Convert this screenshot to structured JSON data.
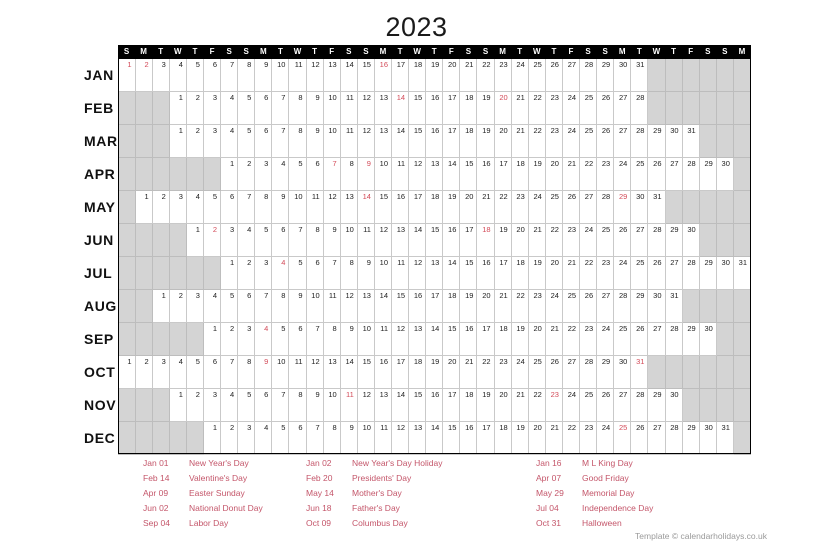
{
  "title": "2023",
  "calendar": {
    "year": 2023,
    "columns": 37,
    "dow_sequence": [
      "S",
      "M",
      "T",
      "W",
      "T",
      "F",
      "S"
    ],
    "header_labels": [
      "S",
      "M",
      "T",
      "W",
      "T",
      "F",
      "S",
      "S",
      "M",
      "T",
      "W",
      "T",
      "F",
      "S",
      "S",
      "M",
      "T",
      "W",
      "T",
      "F",
      "S",
      "S",
      "M",
      "T",
      "W",
      "T",
      "F",
      "S",
      "S",
      "M",
      "T",
      "W",
      "T",
      "F",
      "S",
      "S",
      "M"
    ],
    "months": [
      {
        "label": "JAN",
        "offset": 0,
        "days": 31,
        "holidays": [
          1,
          2,
          16
        ]
      },
      {
        "label": "FEB",
        "offset": 3,
        "days": 28,
        "holidays": [
          14,
          20
        ]
      },
      {
        "label": "MAR",
        "offset": 3,
        "days": 31,
        "holidays": []
      },
      {
        "label": "APR",
        "offset": 6,
        "days": 30,
        "holidays": [
          7,
          9
        ]
      },
      {
        "label": "MAY",
        "offset": 1,
        "days": 31,
        "holidays": [
          14,
          29
        ]
      },
      {
        "label": "JUN",
        "offset": 4,
        "days": 30,
        "holidays": [
          2,
          18
        ]
      },
      {
        "label": "JUL",
        "offset": 6,
        "days": 31,
        "holidays": [
          4
        ]
      },
      {
        "label": "AUG",
        "offset": 2,
        "days": 31,
        "holidays": []
      },
      {
        "label": "SEP",
        "offset": 5,
        "days": 30,
        "holidays": [
          4
        ]
      },
      {
        "label": "OCT",
        "offset": 0,
        "days": 31,
        "holidays": [
          9,
          31
        ]
      },
      {
        "label": "NOV",
        "offset": 3,
        "days": 30,
        "holidays": [
          11,
          23
        ]
      },
      {
        "label": "DEC",
        "offset": 5,
        "days": 31,
        "holidays": [
          25
        ]
      }
    ]
  },
  "holidays": {
    "column1": [
      {
        "date": "Jan 01",
        "name": "New Year's Day"
      },
      {
        "date": "Feb 14",
        "name": "Valentine's Day"
      },
      {
        "date": "Apr 09",
        "name": "Easter Sunday"
      },
      {
        "date": "Jun 02",
        "name": "National Donut Day"
      },
      {
        "date": "Sep 04",
        "name": "Labor Day"
      }
    ],
    "column2": [
      {
        "date": "Jan 02",
        "name": "New Year's Day Holiday"
      },
      {
        "date": "Feb 20",
        "name": "Presidents' Day"
      },
      {
        "date": "May 14",
        "name": "Mother's Day"
      },
      {
        "date": "Jun 18",
        "name": "Father's Day"
      },
      {
        "date": "Oct 09",
        "name": "Columbus Day"
      }
    ],
    "column3": [
      {
        "date": "Jan 16",
        "name": "M L King Day"
      },
      {
        "date": "Apr 07",
        "name": "Good Friday"
      },
      {
        "date": "May 29",
        "name": "Memorial Day"
      },
      {
        "date": "Jul 04",
        "name": "Independence Day"
      },
      {
        "date": "Oct 31",
        "name": "Halloween"
      }
    ]
  },
  "credit": "Template © calendarholidays.co.uk",
  "colors": {
    "holiday_red": "#d34b59",
    "holiday_text": "#c4566a",
    "empty_cell": "#d4d4d4",
    "header_bg": "#000000",
    "grid_line": "#c9c9c9",
    "credit_text": "#9a9a9a"
  }
}
